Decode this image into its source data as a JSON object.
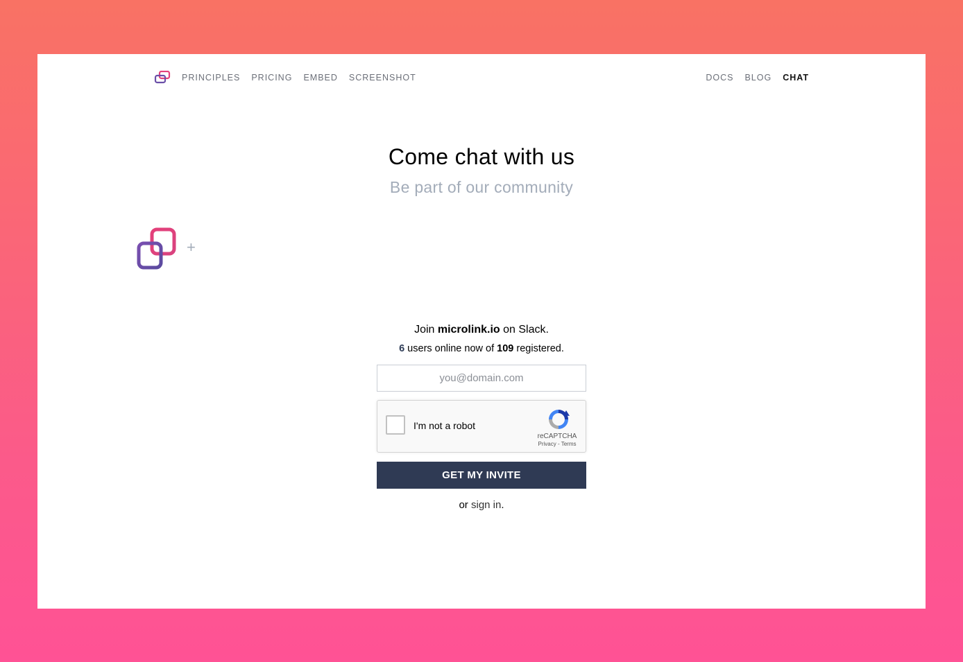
{
  "nav": {
    "left": [
      "PRINCIPLES",
      "PRICING",
      "EMBED",
      "SCREENSHOT"
    ],
    "right": [
      "DOCS",
      "BLOG",
      "CHAT"
    ],
    "active": "CHAT"
  },
  "hero": {
    "title": "Come chat with us",
    "subtitle": "Be part of our community"
  },
  "join": {
    "prefix": "Join ",
    "brand": "microlink.io",
    "suffix": " on Slack."
  },
  "stats": {
    "online": "6",
    "middle": " users online now of ",
    "registered": "109",
    "end": " registered."
  },
  "form": {
    "email_placeholder": "you@domain.com",
    "captcha_label": "I'm not a robot",
    "captcha_brand": "reCAPTCHA",
    "captcha_links": "Privacy - Terms",
    "button": "GET MY INVITE"
  },
  "signin": {
    "prefix": "or ",
    "link": "sign in",
    "suffix": "."
  },
  "icons": {
    "logo": "microlink-logo-icon",
    "plus": "plus-icon",
    "recaptcha": "recaptcha-icon"
  },
  "colors": {
    "bg_top": "#f97264",
    "bg_bottom": "#ff5295",
    "button": "#2f3a54",
    "logo_pink": "#e4407a",
    "logo_purple": "#6b4fa8"
  }
}
